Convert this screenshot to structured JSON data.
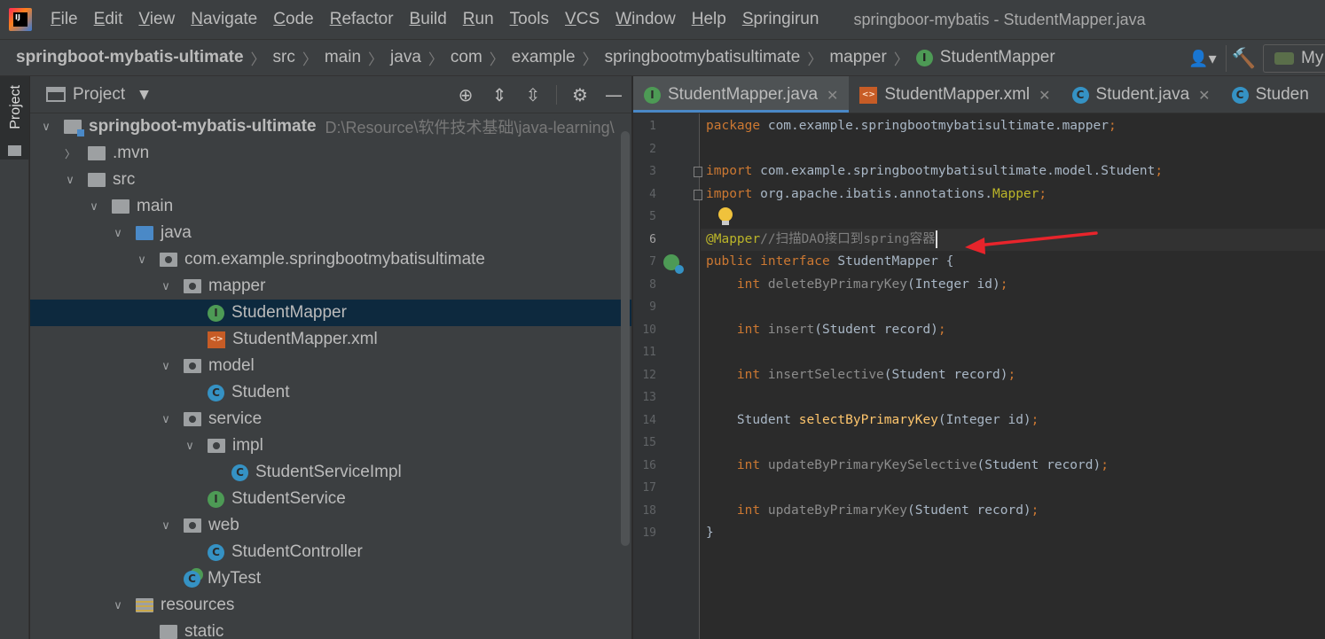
{
  "menubar": {
    "items": [
      "File",
      "Edit",
      "View",
      "Navigate",
      "Code",
      "Refactor",
      "Build",
      "Run",
      "Tools",
      "VCS",
      "Window",
      "Help",
      "Springirun"
    ],
    "window_title": "springboor-mybatis - StudentMapper.java"
  },
  "navbar": {
    "crumbs": [
      "springboot-mybatis-ultimate",
      "src",
      "main",
      "java",
      "com",
      "example",
      "springbootmybatisultimate",
      "mapper",
      "StudentMapper"
    ],
    "run_config_label": "My"
  },
  "stripe": {
    "project_label": "Project"
  },
  "project_panel": {
    "title": "Project",
    "tree": [
      {
        "label": "springboot-mybatis-ultimate",
        "path": "D:\\Resource\\软件技术基础\\java-learning\\",
        "icon": "module-folder-icon",
        "arrow": "down",
        "depth": 0
      },
      {
        "label": ".mvn",
        "icon": "folder-icon",
        "arrow": "right",
        "depth": 1
      },
      {
        "label": "src",
        "icon": "folder-icon",
        "arrow": "down",
        "depth": 1
      },
      {
        "label": "main",
        "icon": "folder-icon",
        "arrow": "down",
        "depth": 2
      },
      {
        "label": "java",
        "icon": "source-folder-icon",
        "arrow": "down",
        "depth": 3
      },
      {
        "label": "com.example.springbootmybatisultimate",
        "icon": "package-icon",
        "arrow": "down",
        "depth": 4
      },
      {
        "label": "mapper",
        "icon": "package-icon",
        "arrow": "down",
        "depth": 5
      },
      {
        "label": "StudentMapper",
        "icon": "interface-icon",
        "arrow": "none",
        "depth": 6,
        "selected": true
      },
      {
        "label": "StudentMapper.xml",
        "icon": "xml-file-icon",
        "arrow": "none",
        "depth": 6
      },
      {
        "label": "model",
        "icon": "package-icon",
        "arrow": "down",
        "depth": 5
      },
      {
        "label": "Student",
        "icon": "class-icon",
        "arrow": "none",
        "depth": 6
      },
      {
        "label": "service",
        "icon": "package-icon",
        "arrow": "down",
        "depth": 5
      },
      {
        "label": "impl",
        "icon": "package-icon",
        "arrow": "down",
        "depth": 6
      },
      {
        "label": "StudentServiceImpl",
        "icon": "class-icon",
        "arrow": "none",
        "depth": 7
      },
      {
        "label": "StudentService",
        "icon": "interface-icon",
        "arrow": "none",
        "depth": 6
      },
      {
        "label": "web",
        "icon": "package-icon",
        "arrow": "down",
        "depth": 5
      },
      {
        "label": "StudentController",
        "icon": "class-icon",
        "arrow": "none",
        "depth": 6
      },
      {
        "label": "MyTest",
        "icon": "test-class-icon",
        "arrow": "none",
        "depth": 5
      },
      {
        "label": "resources",
        "icon": "resources-folder-icon",
        "arrow": "down",
        "depth": 3
      },
      {
        "label": "static",
        "icon": "folder-icon",
        "arrow": "none",
        "depth": 4
      }
    ]
  },
  "editor": {
    "tabs": [
      {
        "label": "StudentMapper.java",
        "icon": "interface-icon",
        "active": true
      },
      {
        "label": "StudentMapper.xml",
        "icon": "xml-file-icon",
        "active": false
      },
      {
        "label": "Student.java",
        "icon": "class-icon",
        "active": false
      },
      {
        "label": "Studen",
        "icon": "class-icon",
        "active": false
      }
    ],
    "line_numbers": [
      "1",
      "2",
      "3",
      "4",
      "5",
      "6",
      "7",
      "8",
      "9",
      "10",
      "11",
      "12",
      "13",
      "14",
      "15",
      "16",
      "17",
      "18",
      "19"
    ],
    "current_line": 6,
    "code": [
      [
        {
          "t": "kw",
          "v": "package "
        },
        {
          "t": "plain",
          "v": "com.example.springbootmybatisultimate.mapper"
        },
        {
          "t": "kw",
          "v": ";"
        }
      ],
      [],
      [
        {
          "t": "kw",
          "v": "import "
        },
        {
          "t": "plain",
          "v": "com.example.springbootmybatisultimate.model.Student"
        },
        {
          "t": "kw",
          "v": ";"
        }
      ],
      [
        {
          "t": "kw",
          "v": "import "
        },
        {
          "t": "plain",
          "v": "org.apache.ibatis.annotations."
        },
        {
          "t": "ann",
          "v": "Mapper"
        },
        {
          "t": "kw",
          "v": ";"
        }
      ],
      [],
      [
        {
          "t": "ann",
          "v": "@Mapper"
        },
        {
          "t": "cmt",
          "v": "//扫描DAO接口到spring容器"
        },
        {
          "t": "caret",
          "v": ""
        }
      ],
      [
        {
          "t": "kw",
          "v": "public interface "
        },
        {
          "t": "plain",
          "v": "StudentMapper {"
        }
      ],
      [
        {
          "t": "plain",
          "v": "    "
        },
        {
          "t": "kw",
          "v": "int "
        },
        {
          "t": "dim",
          "v": "deleteByPrimaryKey"
        },
        {
          "t": "plain",
          "v": "(Integer id)"
        },
        {
          "t": "kw",
          "v": ";"
        }
      ],
      [],
      [
        {
          "t": "plain",
          "v": "    "
        },
        {
          "t": "kw",
          "v": "int "
        },
        {
          "t": "dim",
          "v": "insert"
        },
        {
          "t": "plain",
          "v": "(Student record)"
        },
        {
          "t": "kw",
          "v": ";"
        }
      ],
      [],
      [
        {
          "t": "plain",
          "v": "    "
        },
        {
          "t": "kw",
          "v": "int "
        },
        {
          "t": "dim",
          "v": "insertSelective"
        },
        {
          "t": "plain",
          "v": "(Student record)"
        },
        {
          "t": "kw",
          "v": ";"
        }
      ],
      [],
      [
        {
          "t": "plain",
          "v": "    Student "
        },
        {
          "t": "fn",
          "v": "selectByPrimaryKey"
        },
        {
          "t": "plain",
          "v": "(Integer id)"
        },
        {
          "t": "kw",
          "v": ";"
        }
      ],
      [],
      [
        {
          "t": "plain",
          "v": "    "
        },
        {
          "t": "kw",
          "v": "int "
        },
        {
          "t": "dim",
          "v": "updateByPrimaryKeySelective"
        },
        {
          "t": "plain",
          "v": "(Student record)"
        },
        {
          "t": "kw",
          "v": ";"
        }
      ],
      [],
      [
        {
          "t": "plain",
          "v": "    "
        },
        {
          "t": "kw",
          "v": "int "
        },
        {
          "t": "dim",
          "v": "updateByPrimaryKey"
        },
        {
          "t": "plain",
          "v": "(Student record)"
        },
        {
          "t": "kw",
          "v": ";"
        }
      ],
      [
        {
          "t": "plain",
          "v": "}"
        }
      ]
    ]
  },
  "colors": {
    "keyword": "#cc7832",
    "annotation": "#bbb529",
    "comment": "#808080",
    "method_decl": "#ffc66d",
    "selection": "#0d293e",
    "annotation_arrow": "#e8242b"
  }
}
